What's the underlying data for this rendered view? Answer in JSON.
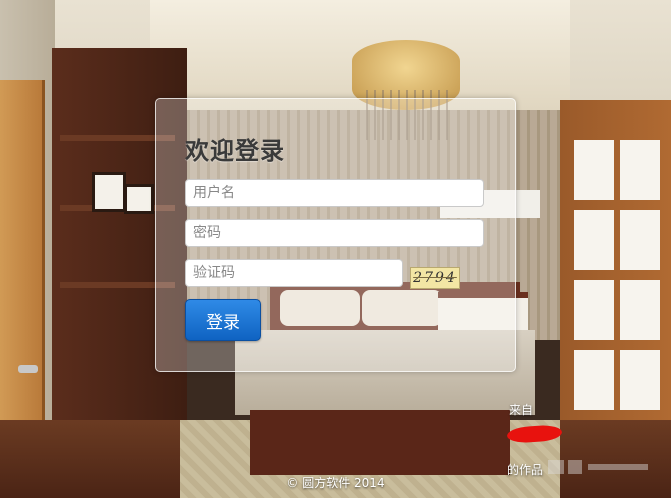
{
  "login": {
    "title": "欢迎登录",
    "username_placeholder": "用户名",
    "password_placeholder": "密码",
    "captcha_placeholder": "验证码",
    "captcha_text": "2794",
    "submit_label": "登录"
  },
  "footer": {
    "copyright": "© 圆方软件 2014",
    "source_label": "来自",
    "author_label": "的作品"
  },
  "colors": {
    "button": "#1a73d6",
    "redaction": "#e8120e"
  }
}
